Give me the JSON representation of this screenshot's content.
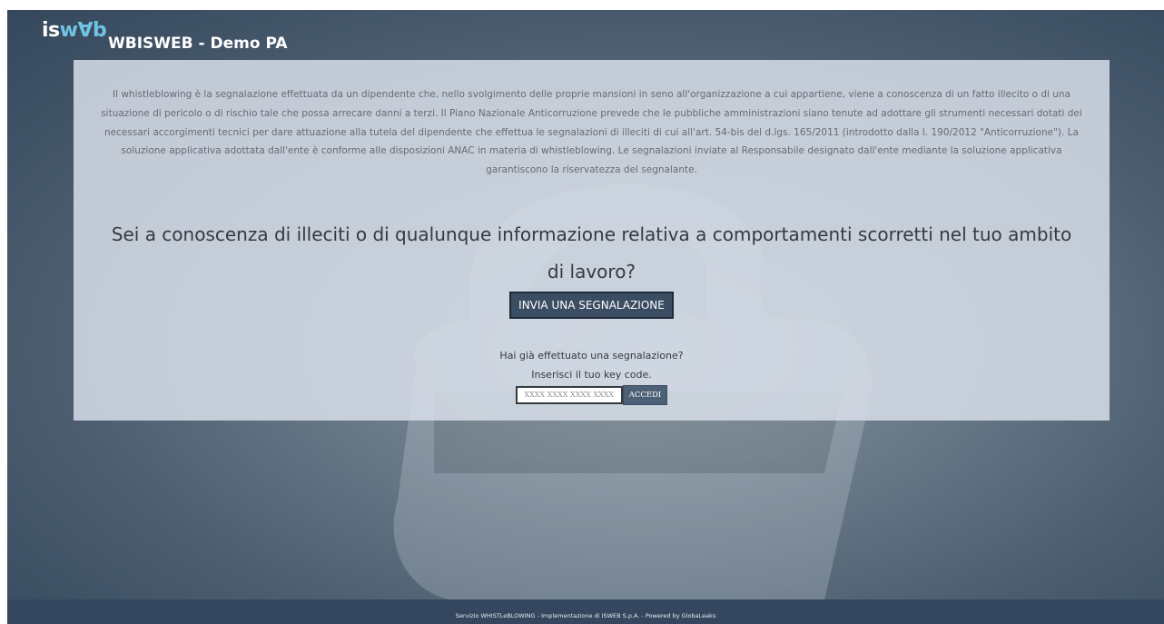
{
  "header": {
    "logo_prefix": "is",
    "logo_accent": "w∀b",
    "site_title": "WBISWEB - Demo PA"
  },
  "intro_text": "Il whistleblowing è la segnalazione effettuata da un dipendente che, nello svolgimento delle proprie mansioni in seno all'organizzazione a cui appartiene, viene a conoscenza di un fatto illecito o di una situazione di pericolo o di rischio tale che possa arrecare danni a terzi. Il Piano Nazionale Anticorruzione prevede che le pubbliche amministrazioni siano tenute ad adottare gli strumenti necessari dotati dei necessari accorgimenti tecnici per dare attuazione alla tutela del dipendente che effettua le segnalazioni di illeciti di cui all'art. 54-bis del d.lgs. 165/2011 (introdotto dalla l. 190/2012 \"Anticorruzione\"). La soluzione applicativa adottata dall'ente è conforme alle disposizioni ANAC in materia di whistleblowing. Le segnalazioni inviate al Responsabile designato dall'ente mediante la soluzione applicativa garantiscono la riservatezza del segnalante.",
  "question": "Sei a conoscenza di illeciti o di qualunque informazione relativa a comportamenti scorretti nel tuo ambito di lavoro?",
  "send_button": "INVIA UNA SEGNALAZIONE",
  "returning": {
    "line1": "Hai già effettuato una segnalazione?",
    "line2": "Inserisci il tuo key code.",
    "keycode_value": "",
    "keycode_placeholder": "XXXX XXXX XXXX XXXX",
    "access_button": "ACCEDI"
  },
  "footer": {
    "text": "Servizio WHISTLeBLOWING - Implementazione di ISWEB S.p.A. - Powered by GlobaLeaks"
  },
  "colors": {
    "panel": "#d6dde8",
    "button": "#3b4d63",
    "footer": "#34475e",
    "logo_accent": "#6fc3e4"
  }
}
